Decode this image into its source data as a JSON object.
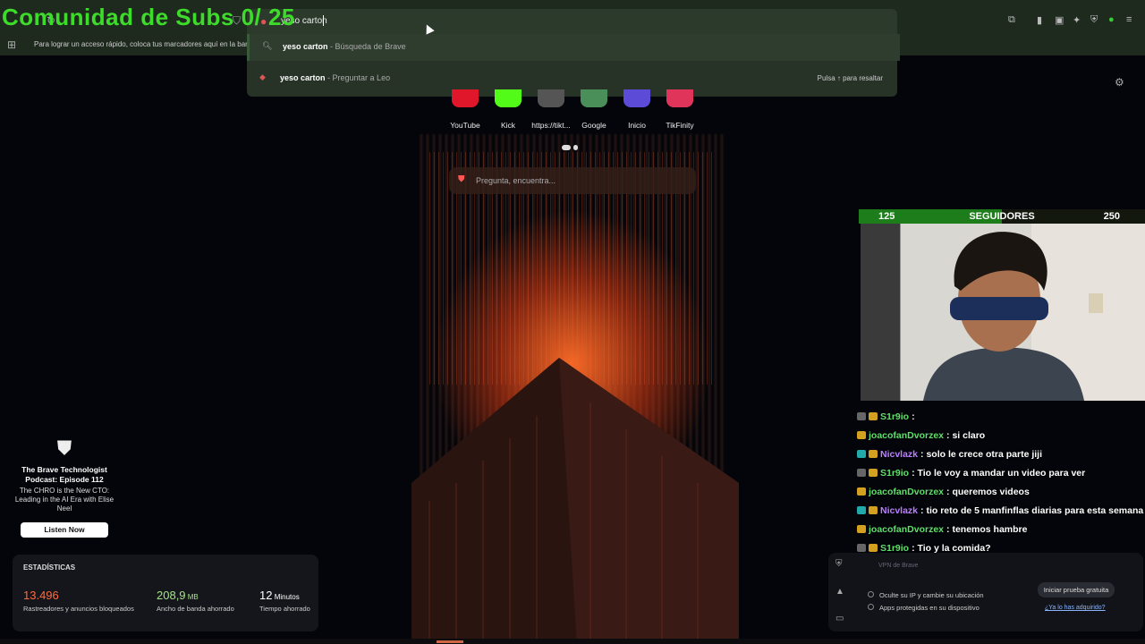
{
  "overlay": {
    "title": "Comunidad de Subs 0/ 25"
  },
  "browser": {
    "omnibox_text": "yeso carton",
    "bookmarks_hint": "Para lograr un acceso rápido, coloca tus marcadores aquí en la barra"
  },
  "suggestions": [
    {
      "bold": "yeso carton",
      "sub": " - Búsqueda de Brave",
      "icon": "search-icon"
    },
    {
      "bold": "yeso carton",
      "sub": " - Preguntar a Leo",
      "icon": "leo-icon",
      "hint": "Pulsa ↑ para resaltar"
    }
  ],
  "shortcuts": [
    {
      "label": "YouTube",
      "color": "#e0162b"
    },
    {
      "label": "Kick",
      "color": "#53fc18"
    },
    {
      "label": "https://tikt...",
      "color": "#555555"
    },
    {
      "label": "Google",
      "color": "#4a8f5a"
    },
    {
      "label": "Inicio",
      "color": "#5b4bd6"
    },
    {
      "label": "TikFinity",
      "color": "#e0345a"
    }
  ],
  "search": {
    "placeholder": "Pregunta, encuentra..."
  },
  "podcast": {
    "title": "The Brave Technologist Podcast: Episode 112",
    "subtitle": "The CHRO is the New CTO: Leading in the AI Era with Elise Neel",
    "button": "Listen Now"
  },
  "stats": {
    "heading": "ESTADÍSTICAS",
    "items": [
      {
        "value": "13.496",
        "unit": "",
        "desc": "Rastreadores y anuncios bloqueados",
        "color": "#ff6a3d"
      },
      {
        "value": "208,9",
        "unit": " MB",
        "desc": "Ancho de banda ahorrado",
        "color": "#a6e08a"
      },
      {
        "value": "12",
        "unit": " Minutos",
        "desc": "Tiempo ahorrado",
        "color": "#ffffff"
      }
    ]
  },
  "followers": {
    "min": "125",
    "label": "SEGUIDORES",
    "max": "250",
    "progress": 0.5
  },
  "chat": [
    {
      "user": "S1r9io",
      "color": "#5fe06a",
      "text": ":",
      "badges": [
        "b3",
        "b2"
      ]
    },
    {
      "user": "joacofanDvorzex",
      "color": "#5fe06a",
      "text": ": si claro",
      "badges": [
        "b2"
      ]
    },
    {
      "user": "Nicvlazk",
      "color": "#b980ff",
      "text": ": solo le crece otra parte jiji",
      "badges": [
        "b1",
        "b2"
      ]
    },
    {
      "user": "S1r9io",
      "color": "#5fe06a",
      "text": ": Tio le voy a mandar un video para ver",
      "badges": [
        "b3",
        "b2"
      ]
    },
    {
      "user": "joacofanDvorzex",
      "color": "#5fe06a",
      "text": ": queremos videos",
      "badges": [
        "b2"
      ]
    },
    {
      "user": "Nicvlazk",
      "color": "#b980ff",
      "text": ": tio reto de 5 manfinflas diarias para esta semana",
      "badges": [
        "b1",
        "b2"
      ]
    },
    {
      "user": "joacofanDvorzex",
      "color": "#5fe06a",
      "text": ": tenemos hambre",
      "badges": [
        "b2"
      ]
    },
    {
      "user": "S1r9io",
      "color": "#5fe06a",
      "text": ": Tio y la comida?",
      "badges": [
        "b3",
        "b2"
      ]
    }
  ],
  "vpn": {
    "faint_title": "VPN de Brave",
    "line1": "Oculte su IP y cambie su ubicación",
    "line2": "Apps protegidas en su dispositivo",
    "trial": "Iniciar prueba gratuita",
    "have": "¿Ya lo has adquirido?"
  }
}
